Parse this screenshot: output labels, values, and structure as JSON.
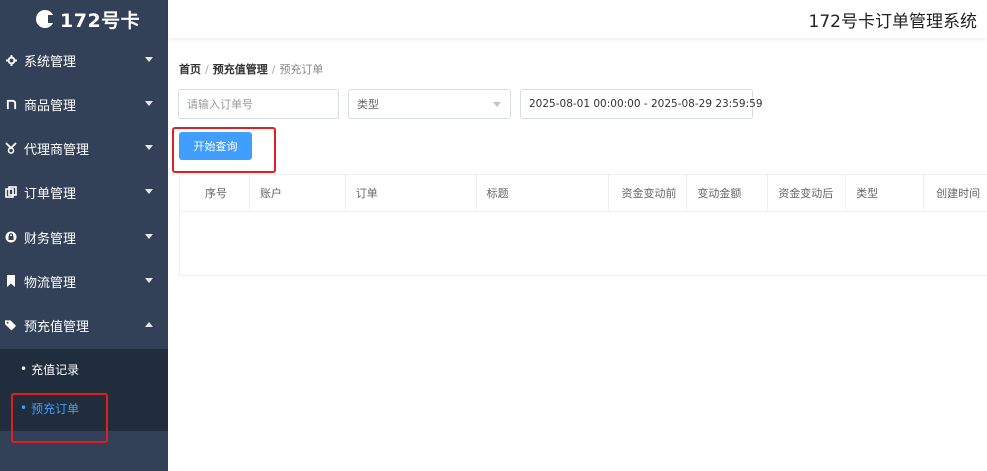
{
  "sidebar": {
    "logo_text": "172号卡",
    "menu": [
      {
        "label": "系统管理",
        "icon": "gear-icon"
      },
      {
        "label": "商品管理",
        "icon": "product-icon"
      },
      {
        "label": "代理商管理",
        "icon": "agent-icon"
      },
      {
        "label": "订单管理",
        "icon": "order-icon"
      },
      {
        "label": "财务管理",
        "icon": "finance-icon"
      },
      {
        "label": "物流管理",
        "icon": "bookmark-icon"
      },
      {
        "label": "预充值管理",
        "icon": "tag-icon",
        "expanded": true
      }
    ],
    "submenu": [
      {
        "label": "充值记录"
      },
      {
        "label": "预充订单",
        "active": true
      }
    ]
  },
  "header": {
    "title": "172号卡订单管理系统"
  },
  "breadcrumb": [
    "首页",
    "预充值管理",
    "预充订单"
  ],
  "filters": {
    "order_placeholder": "请输入订单号",
    "type_select": "类型",
    "date_range": "2025-08-01 00:00:00 - 2025-08-29 23:59:59"
  },
  "search_button": "开始查询",
  "table": {
    "columns": [
      "序号",
      "账户",
      "订单",
      "标题",
      "资金变动前",
      "变动金额",
      "资金变动后",
      "类型",
      "创建时间"
    ],
    "rows": []
  },
  "colors": {
    "sidebar_bg": "#324157",
    "submenu_bg": "#1f2d3d",
    "accent": "#409eff",
    "highlight": "#e02020"
  }
}
